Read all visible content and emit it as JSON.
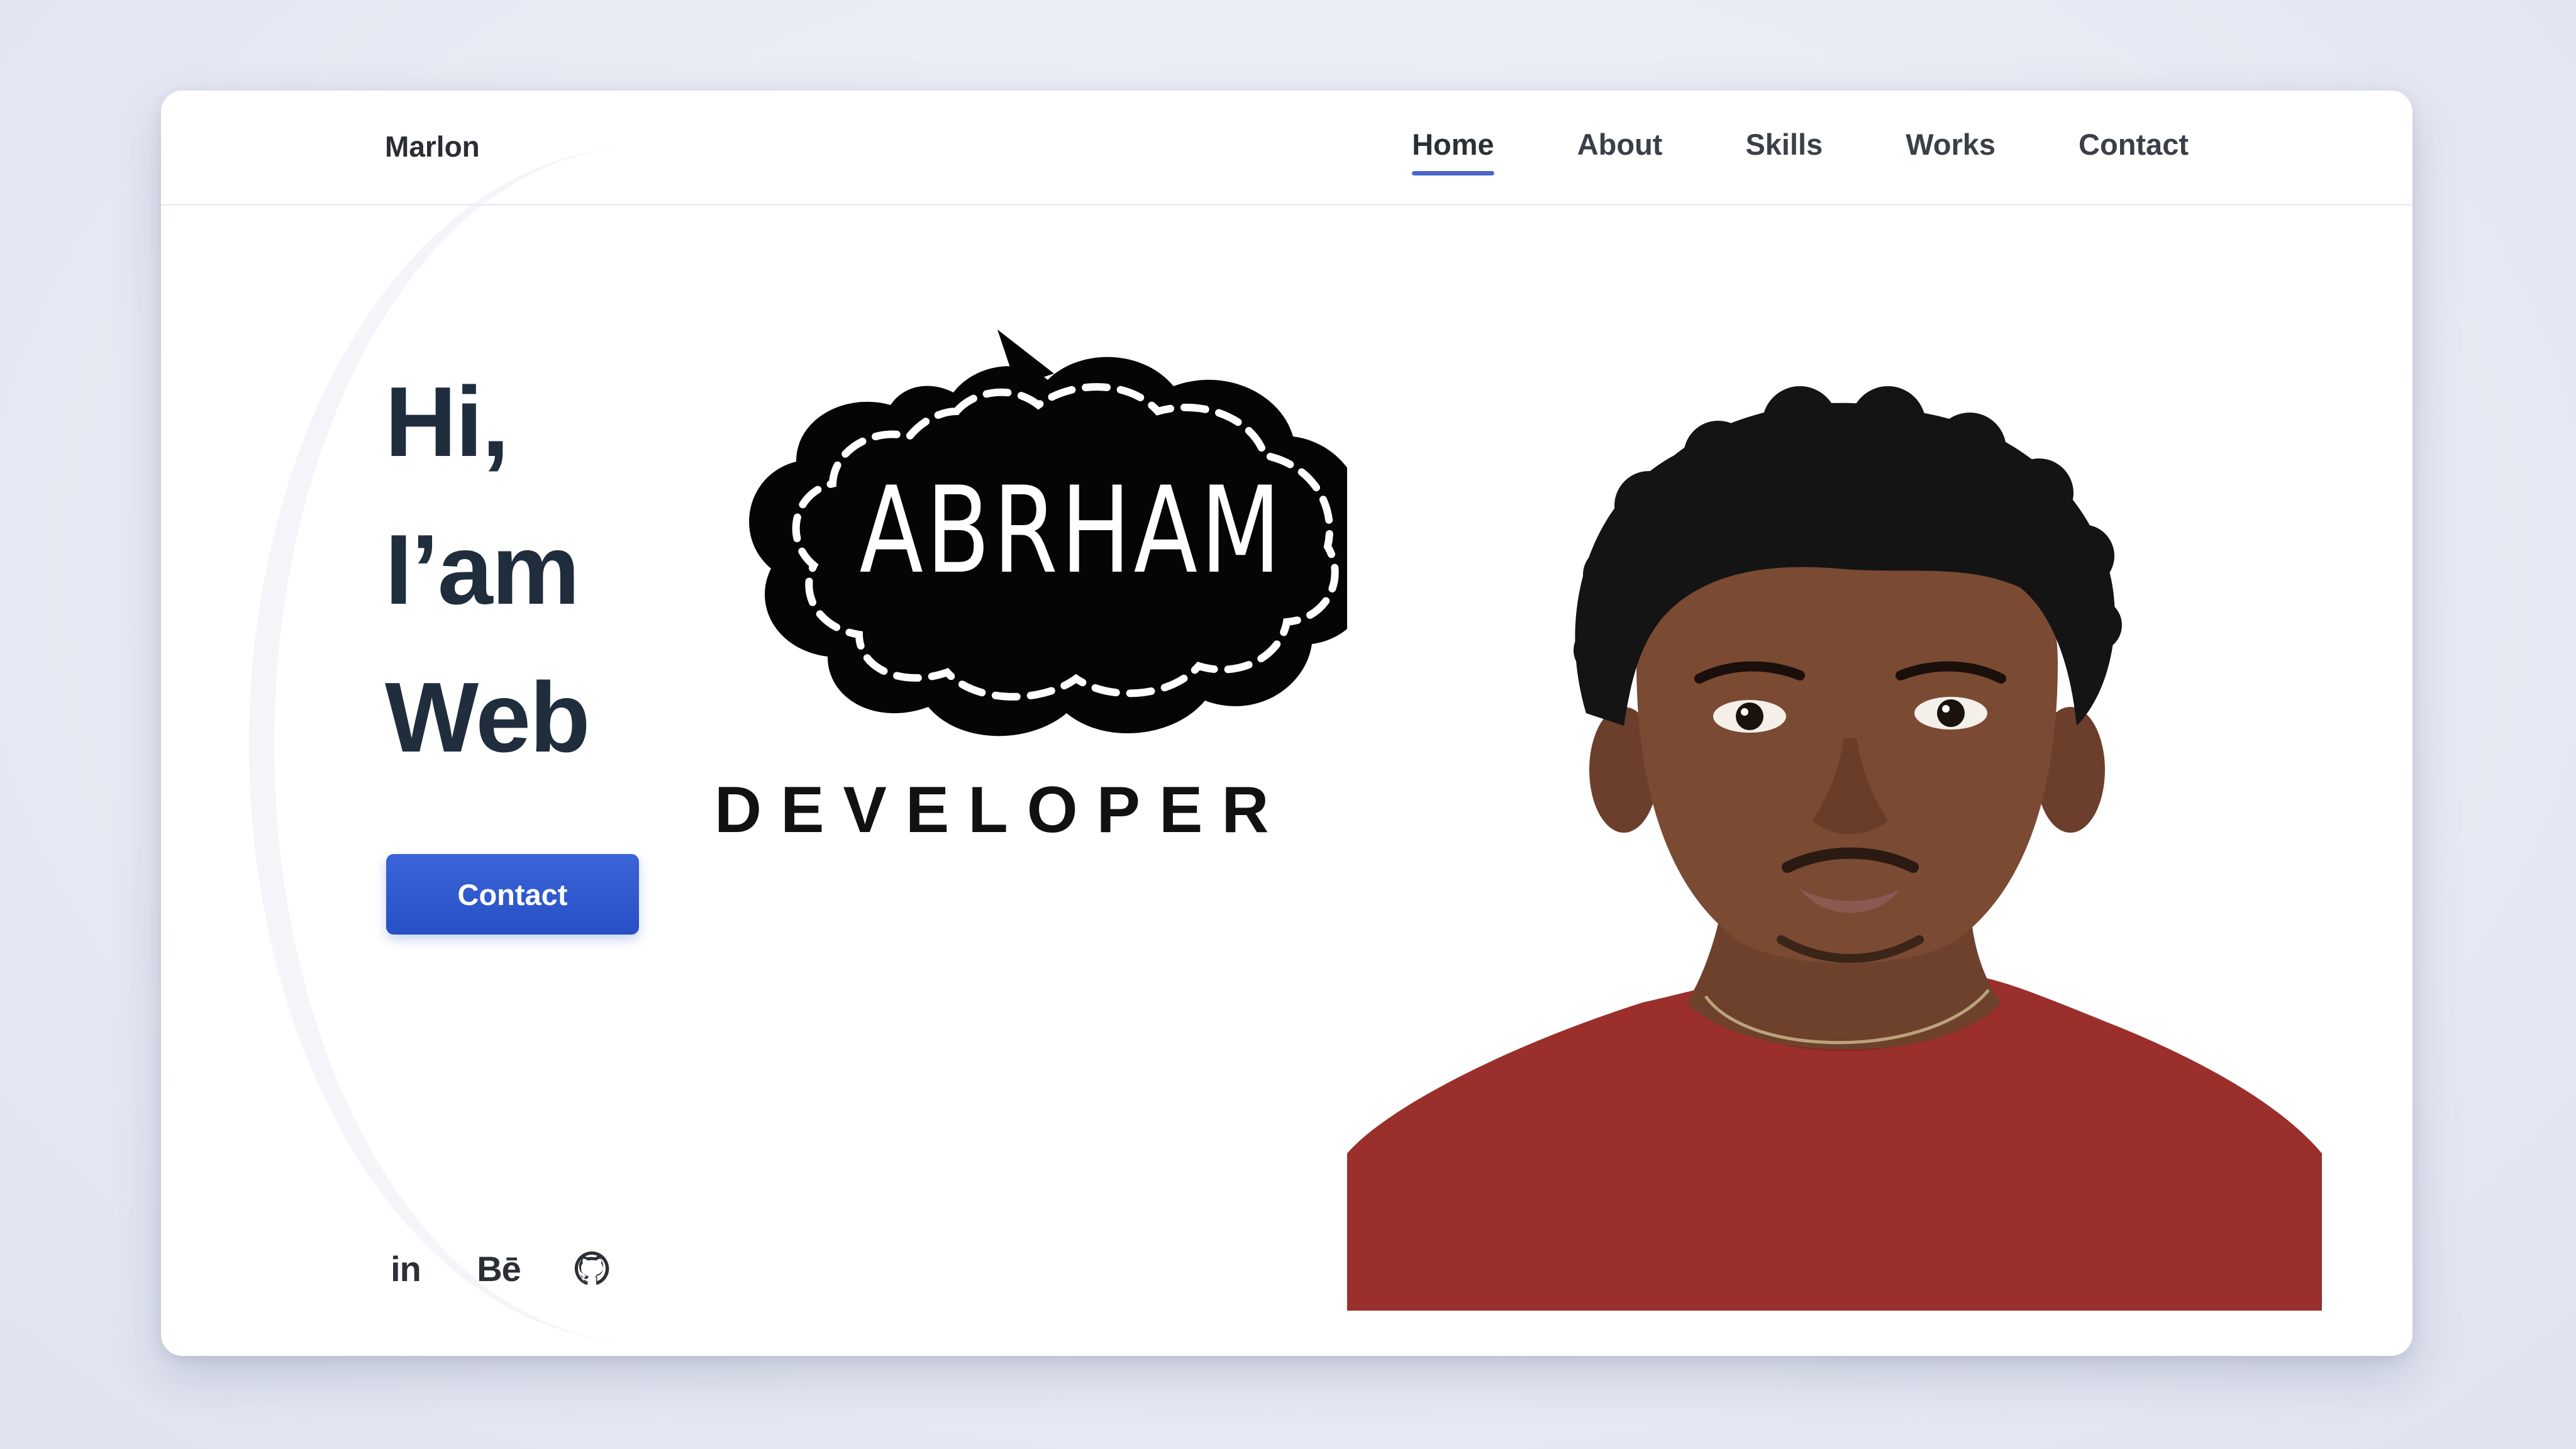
{
  "header": {
    "logo": "Marlon",
    "nav": [
      {
        "label": "Home",
        "active": true
      },
      {
        "label": "About",
        "active": false
      },
      {
        "label": "Skills",
        "active": false
      },
      {
        "label": "Works",
        "active": false
      },
      {
        "label": "Contact",
        "active": false
      }
    ]
  },
  "hero": {
    "line1": "Hi,",
    "line2": "I’am",
    "line3": "Web",
    "badge_name": "ABRHAM",
    "badge_subtitle": "DEVELOPER",
    "contact_button": "Contact"
  },
  "socials": [
    {
      "name": "linkedin",
      "label": "in"
    },
    {
      "name": "behance",
      "label": "Bē"
    },
    {
      "name": "github",
      "label": "github-icon"
    }
  ],
  "colors": {
    "accent": "#2750c6",
    "nav_underline": "#4a67c9",
    "title": "#1f2d3d",
    "shirt": "#9a2f2c",
    "skin": "#7a4a33",
    "hair": "#141414"
  }
}
